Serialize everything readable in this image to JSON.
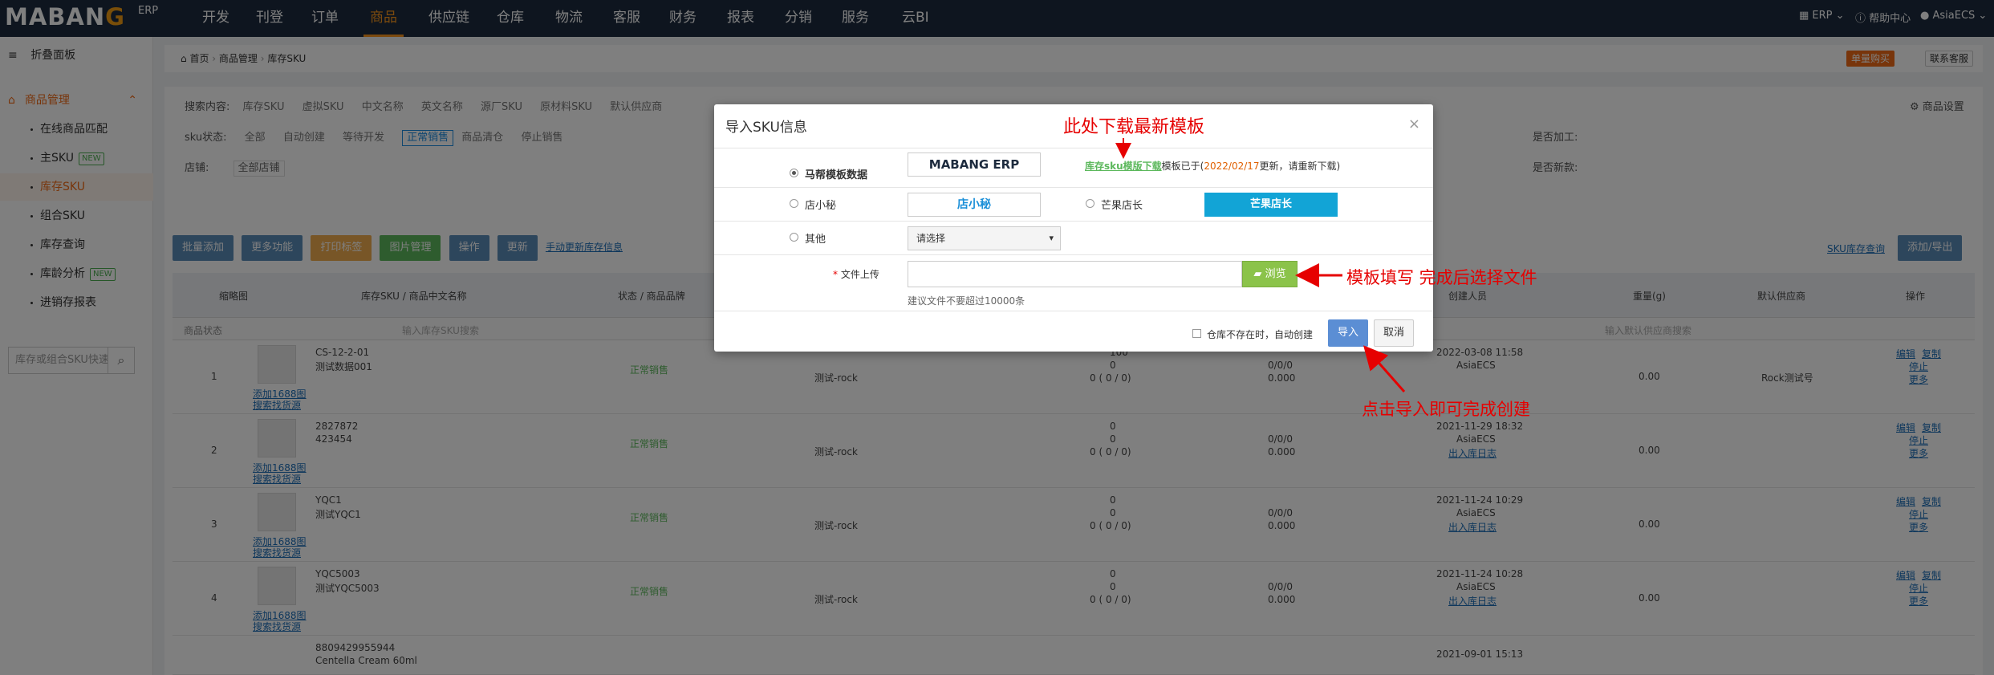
{
  "topbar": {
    "logo_main": "MABAN",
    "logo_g": "G",
    "logo_sup": "ERP",
    "nav": [
      "开发",
      "刊登",
      "订单",
      "商品",
      "供应链",
      "仓库",
      "物流",
      "客服",
      "财务",
      "报表",
      "分销",
      "服务",
      "云BI"
    ],
    "active_nav": "商品",
    "erp_label": "ERP",
    "help_label": "帮助中心",
    "user_label": "AsiaECS"
  },
  "sidebar": {
    "collapse_label": "折叠面板",
    "group_label": "商品管理",
    "items": [
      {
        "label": "在线商品匹配",
        "badge": ""
      },
      {
        "label": "主SKU",
        "badge": "NEW"
      },
      {
        "label": "库存SKU",
        "badge": ""
      },
      {
        "label": "组合SKU",
        "badge": ""
      },
      {
        "label": "库存查询",
        "badge": ""
      },
      {
        "label": "库龄分析",
        "badge": "NEW"
      },
      {
        "label": "进销存报表",
        "badge": ""
      }
    ],
    "active_item": "库存SKU",
    "search_placeholder": "库存或组合SKU快速"
  },
  "breadcrumb": {
    "home": "首页",
    "level1": "商品管理",
    "level2": "库存SKU",
    "buy_label": "单量购买",
    "cs_label": "联系客服"
  },
  "filters": {
    "search_label": "搜索内容:",
    "search_options": [
      "库存SKU",
      "虚拟SKU",
      "中文名称",
      "英文名称",
      "源厂SKU",
      "原材料SKU",
      "默认供应商"
    ],
    "status_label": "sku状态:",
    "status_options": [
      "全部",
      "自动创建",
      "等待开发",
      "正常销售",
      "商品清仓",
      "停止销售"
    ],
    "store_label": "店铺:",
    "store_value": "全部店铺",
    "process_label": "是否加工:",
    "newitem_label": "是否新款:",
    "setting_label": "商品设置"
  },
  "toolbar": {
    "buttons": [
      "批量添加",
      "更多功能",
      "打印标签",
      "图片管理",
      "操作",
      "更新"
    ],
    "sync_link": "手动更新库存信息",
    "right_link": "SKU库存查询",
    "right_button": "添加/导出"
  },
  "table": {
    "headers": [
      "缩略图",
      "库存SKU / 商品中文名称",
      "状态 / 商品品牌",
      "创建人员",
      "重量(g)",
      "默认供应商",
      "操作"
    ],
    "status_filter": "商品状态",
    "sku_filter_placeholder": "输入库存SKU搜索",
    "supplier_filter_placeholder": "输入默认供应商搜索",
    "rows": [
      {
        "idx": "1",
        "sku": "CS-12-2-01",
        "name": "测试数据001",
        "status": "正常销售",
        "creator_tag": "测试-rock",
        "stock": "100",
        "stock2": "0",
        "stock3": "0 ( 0 / 0)",
        "val1": "0/0/0",
        "val2": "0.000",
        "time": "2022-03-08 11:58",
        "user": "AsiaECS",
        "weight": "0.00",
        "supplier": "Rock测试号",
        "link": ""
      },
      {
        "idx": "2",
        "sku": "2827872",
        "name": "423454",
        "status": "正常销售",
        "creator_tag": "测试-rock",
        "stock": "0",
        "stock2": "0",
        "stock3": "0 ( 0 / 0)",
        "val1": "0/0/0",
        "val2": "0.000",
        "time": "2021-11-29 18:32",
        "user": "AsiaECS",
        "weight": "0.00",
        "supplier": "",
        "link": "出入库日志"
      },
      {
        "idx": "3",
        "sku": "YQC1",
        "name": "测试YQC1",
        "status": "正常销售",
        "creator_tag": "测试-rock",
        "stock": "0",
        "stock2": "0",
        "stock3": "0 ( 0 / 0)",
        "val1": "0/0/0",
        "val2": "0.000",
        "time": "2021-11-24 10:29",
        "user": "AsiaECS",
        "weight": "0.00",
        "supplier": "",
        "link": "出入库日志"
      },
      {
        "idx": "4",
        "sku": "YQC5003",
        "name": "测试YQC5003",
        "status": "正常销售",
        "creator_tag": "测试-rock",
        "stock": "0",
        "stock2": "0",
        "stock3": "0 ( 0 / 0)",
        "val1": "0/0/0",
        "val2": "0.000",
        "time": "2021-11-24 10:28",
        "user": "AsiaECS",
        "weight": "0.00",
        "supplier": "",
        "link": "出入库日志"
      }
    ],
    "row5_sku": "8809429955944",
    "row5_name": "Centella Cream 60ml",
    "row5_time": "2021-09-01 15:13",
    "img_links": [
      "添加1688图",
      "搜索找货源"
    ],
    "ops": [
      "编辑",
      "复制",
      "停止",
      "更多"
    ]
  },
  "modal": {
    "title": "导入SKU信息",
    "close": "×",
    "option_mabang": "马帮模板数据",
    "mabang_logo": "MABANG ERP",
    "template_link": "库存sku模版下载",
    "template_text1": "模板已于(",
    "template_date": "2022/02/17",
    "template_text2": "更新，请重新下载)",
    "option_dxm": "店小秘",
    "dxm_logo": "店小秘",
    "option_mgdz": "芒果店长",
    "mgdz_logo": "芒果店长",
    "option_other": "其他",
    "select_placeholder": "请选择",
    "file_label": "文件上传",
    "browse": "浏览",
    "file_hint": "建议文件不要超过10000条",
    "checkbox_label": "仓库不存在时，自动创建",
    "import": "导入",
    "cancel": "取消"
  },
  "annotations": {
    "download": "此处下载最新模板",
    "fill": "模板填写 完成后选择文件",
    "import": "点击导入即可完成创建"
  }
}
